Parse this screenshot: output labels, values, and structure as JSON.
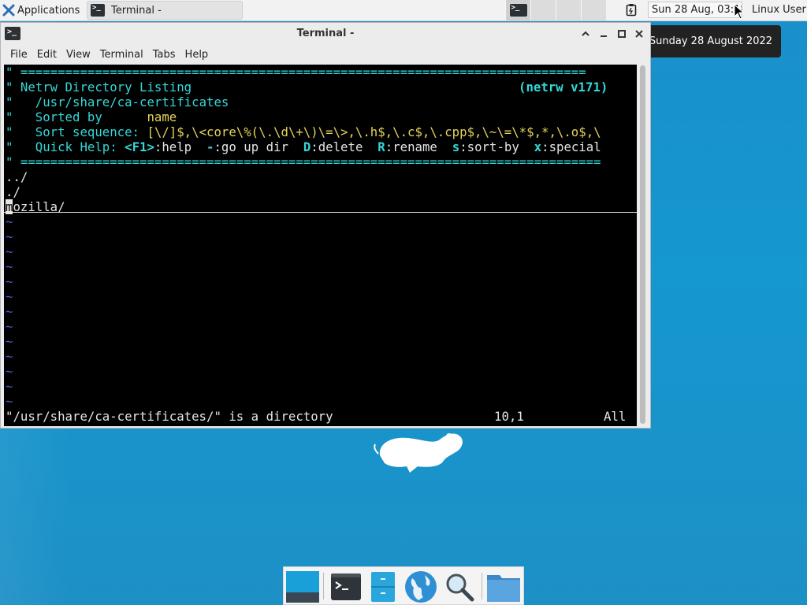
{
  "top_panel": {
    "apps_label": "Applications",
    "task_label": "Terminal -",
    "clock": "Sun 28 Aug, 03:18",
    "user": "Linux User"
  },
  "tooltip": "Sunday 28 August 2022",
  "window": {
    "title": "Terminal -",
    "menu": [
      "File",
      "Edit",
      "View",
      "Terminal",
      "Tabs",
      "Help"
    ]
  },
  "terminal": {
    "rule": "\" ============================================================================",
    "rule_long": "\" ==============================================================================",
    "header_prefix": "\" ",
    "header_title": "Netrw Directory Listing",
    "header_version": "(netrw v171)",
    "path_prefix": "\"   ",
    "path": "/usr/share/ca-certificates",
    "sorted_label": "\"   Sorted by      ",
    "sorted_value": "name",
    "sortseq_label": "\"   Sort sequence: ",
    "sortseq_value": "[\\/]$,\\<core\\%(\\.\\d\\+\\)\\=\\>,\\.h$,\\.c$,\\.cpp$,\\~\\=\\*$,*,\\.o$,\\",
    "quickhelp_label": "\"   Quick Help: ",
    "quickhelp": {
      "k1": "<F1>",
      "v1": ":help  ",
      "k2": "-",
      "v2": ":go up dir  ",
      "k3": "D",
      "v3": ":delete  ",
      "k4": "R",
      "v4": ":rename  ",
      "k5": "s",
      "v5": ":sort-by  ",
      "k6": "x",
      "v6": ":special"
    },
    "entries": [
      "../",
      "./"
    ],
    "selected_first": "m",
    "selected_rest": "ozilla/",
    "tilde": "~",
    "status_msg": "\"/usr/share/ca-certificates/\" is a directory",
    "status_pos": "10,1",
    "status_scroll": "All"
  },
  "colors": {
    "desktop": "#1597cf",
    "terminal_bg": "#000000",
    "netrw_cyan": "#35d7d7",
    "netrw_yellow": "#e6d35b",
    "tilde_blue": "#4a5ccf"
  },
  "dock": [
    "show-desktop-icon",
    "terminal-icon",
    "file-manager-icon",
    "web-browser-icon",
    "app-finder-icon",
    "folder-icon"
  ]
}
